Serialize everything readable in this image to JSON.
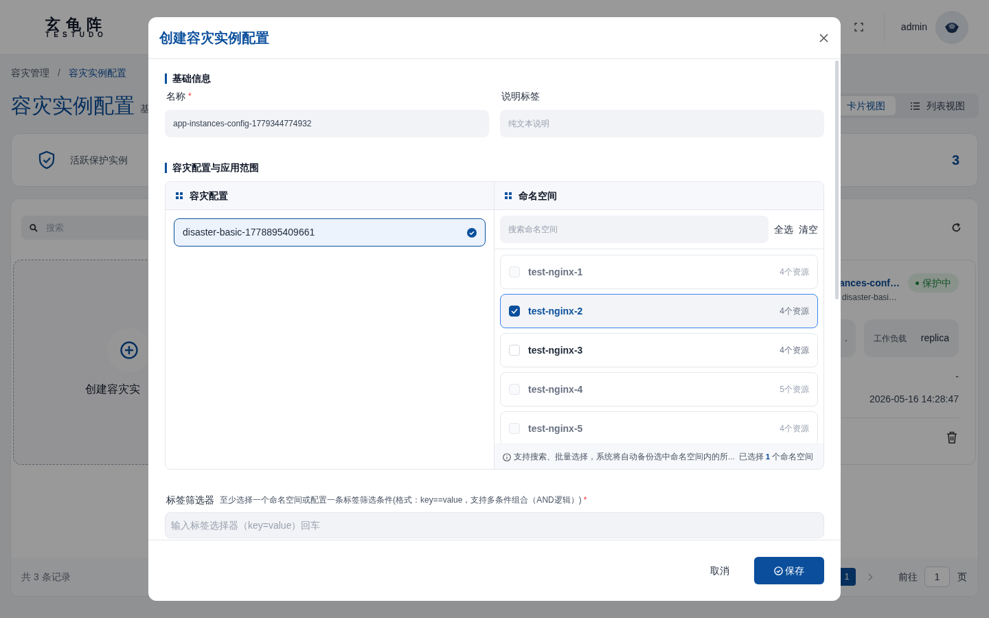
{
  "header": {
    "logo": "玄龟阵",
    "logo_sub": "TESTUDO",
    "user": "admin"
  },
  "breadcrumb": {
    "items": [
      {
        "label": "容灾管理",
        "selected": false
      },
      {
        "label": "容灾实例配置",
        "selected": true
      }
    ],
    "separator": "/"
  },
  "page_title": "容灾实例配置",
  "page_subtitle": "基",
  "view_tabs": [
    {
      "label": "卡片视图",
      "selected": true
    },
    {
      "label": "列表视图",
      "selected": false
    }
  ],
  "stats": {
    "label": "活跃保护实例",
    "value": "3"
  },
  "search": {
    "placeholder": "搜索"
  },
  "create_card": {
    "label": "创建容灾实"
  },
  "instance_card": {
    "title": "ances-conf…",
    "status": "保护中",
    "subtitle": "disaster-basi…",
    "metrics": [
      {
        "value": "."
      },
      {
        "label": "工作负载",
        "value": "replica"
      }
    ],
    "fields": [
      "-",
      "2026-05-16 14:28:47"
    ]
  },
  "footer_total": "共 3 条记录",
  "pagination": {
    "pages": [
      {
        "label": "1",
        "selected": true
      }
    ],
    "goto_label": "前往",
    "goto_value": "1",
    "goto_suffix": "页"
  },
  "modal": {
    "title": "创建容灾实例配置",
    "basic": {
      "title": "基础信息",
      "name": {
        "label": "名称",
        "required_mark": "*",
        "value": "app-instances-config-1779344774932"
      },
      "note": {
        "label": "说明标签",
        "placeholder": "纯文本说明"
      }
    },
    "scope": {
      "title": "容灾配置与应用范围",
      "config_heading": "容灾配置",
      "configs": [
        {
          "label": "disaster-basic-1778895409661",
          "selected": true
        }
      ],
      "namespace_heading": "命名空间",
      "namespace_search": {
        "placeholder": "搜索命名空间"
      },
      "select_all": "全选",
      "clear": "清空",
      "namespaces": [
        {
          "name": "test-nginx-1",
          "count": "4个资源",
          "checked": false,
          "disabled": true
        },
        {
          "name": "test-nginx-2",
          "count": "4个资源",
          "checked": true,
          "disabled": false
        },
        {
          "name": "test-nginx-3",
          "count": "4个资源",
          "checked": false,
          "disabled": false
        },
        {
          "name": "test-nginx-4",
          "count": "5个资源",
          "checked": false,
          "disabled": true
        },
        {
          "name": "test-nginx-5",
          "count": "4个资源",
          "checked": false,
          "disabled": true
        }
      ],
      "hint": "支持搜索、批量选择，系统将自动备份选中命名空间内的所...",
      "selected_count": "已选择 **1** 个命名空间"
    },
    "label_filter": {
      "label": "标签筛选器",
      "hint": "至少选择一个命名空间或配置一条标签筛选条件(格式：key==value，支持多条件组合（AND逻辑）)",
      "required_mark": "*",
      "placeholder": "输入标签选择器（key=value）回车"
    },
    "buttons": {
      "cancel": "取消",
      "save": "保存"
    }
  }
}
